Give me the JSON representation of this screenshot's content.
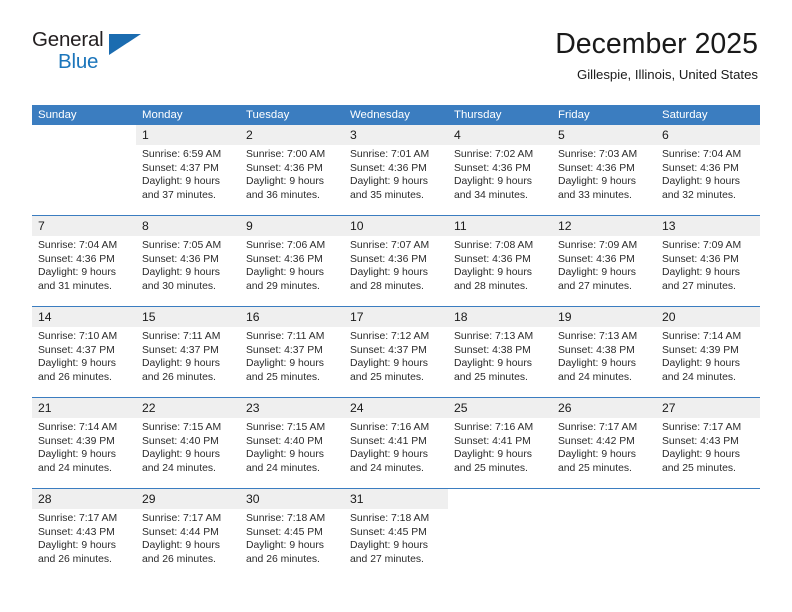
{
  "brand": {
    "line1": "General",
    "line2": "Blue",
    "triangle_color": "#1b6cb0",
    "blue_color": "#1b75bb",
    "dark_color": "#231f20"
  },
  "header": {
    "title": "December 2025",
    "subtitle": "Gillespie, Illinois, United States"
  },
  "theme": {
    "header_row_bg": "#3b7dc0",
    "day_number_bg": "#efefef",
    "week_divider": "#3b7dc0",
    "text": "#1a1a1a"
  },
  "columns": [
    "Sunday",
    "Monday",
    "Tuesday",
    "Wednesday",
    "Thursday",
    "Friday",
    "Saturday"
  ],
  "weeks": [
    [
      {
        "day": "",
        "sunrise": "",
        "sunset": "",
        "daylight1": "",
        "daylight2": "",
        "empty": true
      },
      {
        "day": "1",
        "sunrise": "Sunrise: 6:59 AM",
        "sunset": "Sunset: 4:37 PM",
        "daylight1": "Daylight: 9 hours",
        "daylight2": "and 37 minutes."
      },
      {
        "day": "2",
        "sunrise": "Sunrise: 7:00 AM",
        "sunset": "Sunset: 4:36 PM",
        "daylight1": "Daylight: 9 hours",
        "daylight2": "and 36 minutes."
      },
      {
        "day": "3",
        "sunrise": "Sunrise: 7:01 AM",
        "sunset": "Sunset: 4:36 PM",
        "daylight1": "Daylight: 9 hours",
        "daylight2": "and 35 minutes."
      },
      {
        "day": "4",
        "sunrise": "Sunrise: 7:02 AM",
        "sunset": "Sunset: 4:36 PM",
        "daylight1": "Daylight: 9 hours",
        "daylight2": "and 34 minutes."
      },
      {
        "day": "5",
        "sunrise": "Sunrise: 7:03 AM",
        "sunset": "Sunset: 4:36 PM",
        "daylight1": "Daylight: 9 hours",
        "daylight2": "and 33 minutes."
      },
      {
        "day": "6",
        "sunrise": "Sunrise: 7:04 AM",
        "sunset": "Sunset: 4:36 PM",
        "daylight1": "Daylight: 9 hours",
        "daylight2": "and 32 minutes."
      }
    ],
    [
      {
        "day": "7",
        "sunrise": "Sunrise: 7:04 AM",
        "sunset": "Sunset: 4:36 PM",
        "daylight1": "Daylight: 9 hours",
        "daylight2": "and 31 minutes."
      },
      {
        "day": "8",
        "sunrise": "Sunrise: 7:05 AM",
        "sunset": "Sunset: 4:36 PM",
        "daylight1": "Daylight: 9 hours",
        "daylight2": "and 30 minutes."
      },
      {
        "day": "9",
        "sunrise": "Sunrise: 7:06 AM",
        "sunset": "Sunset: 4:36 PM",
        "daylight1": "Daylight: 9 hours",
        "daylight2": "and 29 minutes."
      },
      {
        "day": "10",
        "sunrise": "Sunrise: 7:07 AM",
        "sunset": "Sunset: 4:36 PM",
        "daylight1": "Daylight: 9 hours",
        "daylight2": "and 28 minutes."
      },
      {
        "day": "11",
        "sunrise": "Sunrise: 7:08 AM",
        "sunset": "Sunset: 4:36 PM",
        "daylight1": "Daylight: 9 hours",
        "daylight2": "and 28 minutes."
      },
      {
        "day": "12",
        "sunrise": "Sunrise: 7:09 AM",
        "sunset": "Sunset: 4:36 PM",
        "daylight1": "Daylight: 9 hours",
        "daylight2": "and 27 minutes."
      },
      {
        "day": "13",
        "sunrise": "Sunrise: 7:09 AM",
        "sunset": "Sunset: 4:36 PM",
        "daylight1": "Daylight: 9 hours",
        "daylight2": "and 27 minutes."
      }
    ],
    [
      {
        "day": "14",
        "sunrise": "Sunrise: 7:10 AM",
        "sunset": "Sunset: 4:37 PM",
        "daylight1": "Daylight: 9 hours",
        "daylight2": "and 26 minutes."
      },
      {
        "day": "15",
        "sunrise": "Sunrise: 7:11 AM",
        "sunset": "Sunset: 4:37 PM",
        "daylight1": "Daylight: 9 hours",
        "daylight2": "and 26 minutes."
      },
      {
        "day": "16",
        "sunrise": "Sunrise: 7:11 AM",
        "sunset": "Sunset: 4:37 PM",
        "daylight1": "Daylight: 9 hours",
        "daylight2": "and 25 minutes."
      },
      {
        "day": "17",
        "sunrise": "Sunrise: 7:12 AM",
        "sunset": "Sunset: 4:37 PM",
        "daylight1": "Daylight: 9 hours",
        "daylight2": "and 25 minutes."
      },
      {
        "day": "18",
        "sunrise": "Sunrise: 7:13 AM",
        "sunset": "Sunset: 4:38 PM",
        "daylight1": "Daylight: 9 hours",
        "daylight2": "and 25 minutes."
      },
      {
        "day": "19",
        "sunrise": "Sunrise: 7:13 AM",
        "sunset": "Sunset: 4:38 PM",
        "daylight1": "Daylight: 9 hours",
        "daylight2": "and 24 minutes."
      },
      {
        "day": "20",
        "sunrise": "Sunrise: 7:14 AM",
        "sunset": "Sunset: 4:39 PM",
        "daylight1": "Daylight: 9 hours",
        "daylight2": "and 24 minutes."
      }
    ],
    [
      {
        "day": "21",
        "sunrise": "Sunrise: 7:14 AM",
        "sunset": "Sunset: 4:39 PM",
        "daylight1": "Daylight: 9 hours",
        "daylight2": "and 24 minutes."
      },
      {
        "day": "22",
        "sunrise": "Sunrise: 7:15 AM",
        "sunset": "Sunset: 4:40 PM",
        "daylight1": "Daylight: 9 hours",
        "daylight2": "and 24 minutes."
      },
      {
        "day": "23",
        "sunrise": "Sunrise: 7:15 AM",
        "sunset": "Sunset: 4:40 PM",
        "daylight1": "Daylight: 9 hours",
        "daylight2": "and 24 minutes."
      },
      {
        "day": "24",
        "sunrise": "Sunrise: 7:16 AM",
        "sunset": "Sunset: 4:41 PM",
        "daylight1": "Daylight: 9 hours",
        "daylight2": "and 24 minutes."
      },
      {
        "day": "25",
        "sunrise": "Sunrise: 7:16 AM",
        "sunset": "Sunset: 4:41 PM",
        "daylight1": "Daylight: 9 hours",
        "daylight2": "and 25 minutes."
      },
      {
        "day": "26",
        "sunrise": "Sunrise: 7:17 AM",
        "sunset": "Sunset: 4:42 PM",
        "daylight1": "Daylight: 9 hours",
        "daylight2": "and 25 minutes."
      },
      {
        "day": "27",
        "sunrise": "Sunrise: 7:17 AM",
        "sunset": "Sunset: 4:43 PM",
        "daylight1": "Daylight: 9 hours",
        "daylight2": "and 25 minutes."
      }
    ],
    [
      {
        "day": "28",
        "sunrise": "Sunrise: 7:17 AM",
        "sunset": "Sunset: 4:43 PM",
        "daylight1": "Daylight: 9 hours",
        "daylight2": "and 26 minutes."
      },
      {
        "day": "29",
        "sunrise": "Sunrise: 7:17 AM",
        "sunset": "Sunset: 4:44 PM",
        "daylight1": "Daylight: 9 hours",
        "daylight2": "and 26 minutes."
      },
      {
        "day": "30",
        "sunrise": "Sunrise: 7:18 AM",
        "sunset": "Sunset: 4:45 PM",
        "daylight1": "Daylight: 9 hours",
        "daylight2": "and 26 minutes."
      },
      {
        "day": "31",
        "sunrise": "Sunrise: 7:18 AM",
        "sunset": "Sunset: 4:45 PM",
        "daylight1": "Daylight: 9 hours",
        "daylight2": "and 27 minutes."
      },
      {
        "day": "",
        "sunrise": "",
        "sunset": "",
        "daylight1": "",
        "daylight2": "",
        "empty": true
      },
      {
        "day": "",
        "sunrise": "",
        "sunset": "",
        "daylight1": "",
        "daylight2": "",
        "empty": true
      },
      {
        "day": "",
        "sunrise": "",
        "sunset": "",
        "daylight1": "",
        "daylight2": "",
        "empty": true
      }
    ]
  ]
}
